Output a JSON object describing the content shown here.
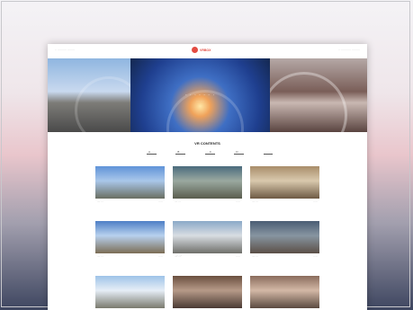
{
  "topbar": {
    "left_text": "·· ·········· ········",
    "right_text": "·· ··········· ·········",
    "logo_text": "VRBOX"
  },
  "hero": {
    "title": "· · · · · · ·",
    "subtitle": "·· ·· ·· ··"
  },
  "section": {
    "title": "VR CONTENTS"
  },
  "tabs": [
    "A ····",
    "B ····",
    "·· C ·",
    "D ····",
    "···· ·"
  ],
  "more_text": "···· ····",
  "thumbs": [
    {
      "c1": "#5f93d8",
      "c2": "#a9c7ea",
      "c3": "#6a6f62",
      "a": "···· · ··",
      "b": "·· ···"
    },
    {
      "c1": "#4a6b7d",
      "c2": "#9aa9a0",
      "c3": "#5a5d4e",
      "a": "···· · ··",
      "b": "·· ···"
    },
    {
      "c1": "#a98d6a",
      "c2": "#d9c9ad",
      "c3": "#6e5a44",
      "a": "···· · ··",
      "b": "·· ···"
    },
    {
      "c1": "#4d7ec6",
      "c2": "#b8d1ee",
      "c3": "#7b6d55",
      "a": "···· · ··",
      "b": "·· ···"
    },
    {
      "c1": "#8aa9c8",
      "c2": "#d8dde2",
      "c3": "#6f6f6a",
      "a": "···· · ··",
      "b": "·· ···"
    },
    {
      "c1": "#4a5d74",
      "c2": "#8795a1",
      "c3": "#5b4f47",
      "a": "···· · ··",
      "b": "·· ···"
    },
    {
      "c1": "#9ec3e8",
      "c2": "#e6eef6",
      "c3": "#7a7a6e",
      "a": "",
      "b": ""
    },
    {
      "c1": "#6a4f3f",
      "c2": "#b69a88",
      "c3": "#4a3a33",
      "a": "",
      "b": ""
    },
    {
      "c1": "#8a6c5c",
      "c2": "#d3b8a6",
      "c3": "#5b4a40",
      "a": "",
      "b": ""
    }
  ]
}
